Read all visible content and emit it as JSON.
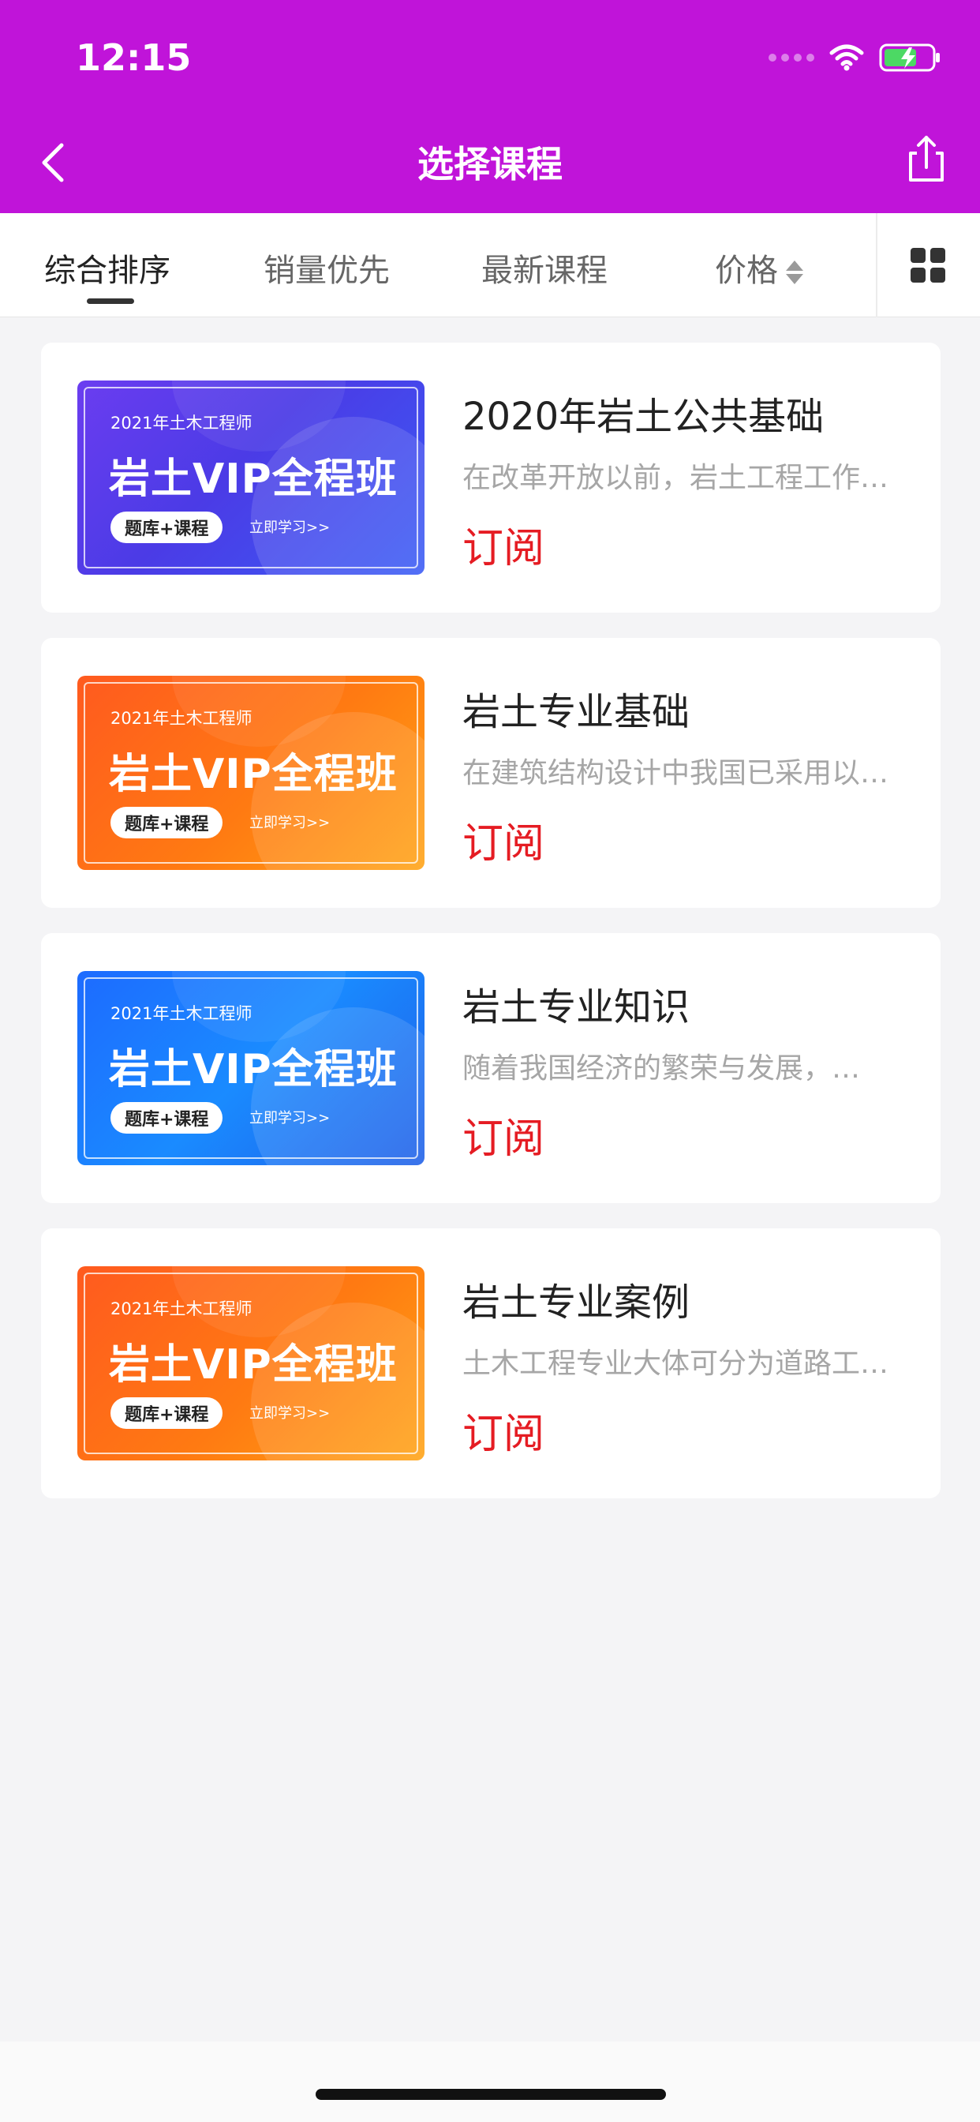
{
  "status_bar": {
    "time": "12:15"
  },
  "nav": {
    "title": "选择课程"
  },
  "tabs": [
    {
      "label": "综合排序",
      "active": true
    },
    {
      "label": "销量优先",
      "active": false
    },
    {
      "label": "最新课程",
      "active": false
    },
    {
      "label": "价格",
      "active": false
    }
  ],
  "thumbnail_text": {
    "year": "2021年土木工程师",
    "main": "岩土VIP全程班",
    "pill": "题库+课程",
    "link": "立即学习>>"
  },
  "courses": [
    {
      "title": "2020年岩土公共基础",
      "desc": "在改革开放以前，岩土工程工作…",
      "action": "订阅",
      "thumb_color": "blue-purple"
    },
    {
      "title": "岩土专业基础",
      "desc": "在建筑结构设计中我国已采用以…",
      "action": "订阅",
      "thumb_color": "orange"
    },
    {
      "title": "岩土专业知识",
      "desc": "随着我国经济的繁荣与发展，…",
      "action": "订阅",
      "thumb_color": "blue"
    },
    {
      "title": "岩土专业案例",
      "desc": "土木工程专业大体可分为道路工…",
      "action": "订阅",
      "thumb_color": "orange"
    }
  ],
  "colors": {
    "header": "#c014d9",
    "accent_red": "#e51c23"
  }
}
